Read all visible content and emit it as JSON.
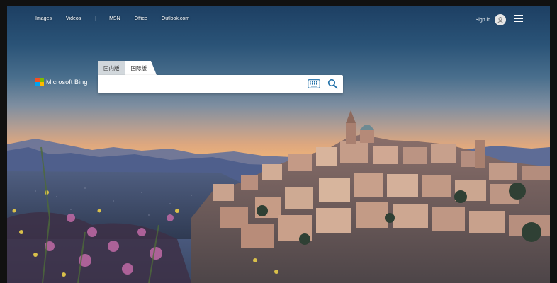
{
  "nav": {
    "items": [
      "Images",
      "Videos",
      "MSN",
      "Office",
      "Outlook.com"
    ],
    "separator": "|"
  },
  "account": {
    "signin_label": "Sign in",
    "avatar_icon": "person-icon",
    "menu_icon": "hamburger-menu-icon"
  },
  "brand": {
    "logo_text": "Microsoft Bing",
    "logo_colors": [
      "#f25022",
      "#7fba00",
      "#00a4ef",
      "#ffb900"
    ]
  },
  "search": {
    "tabs": [
      "国内版",
      "国际版"
    ],
    "selected_tab": "国际版",
    "value": "",
    "placeholder": "",
    "keyboard_icon": "keyboard-icon",
    "search_icon": "search-icon",
    "accent": "#1e6fa8"
  },
  "background": {
    "subject": "hilltop-town-at-sunset"
  }
}
